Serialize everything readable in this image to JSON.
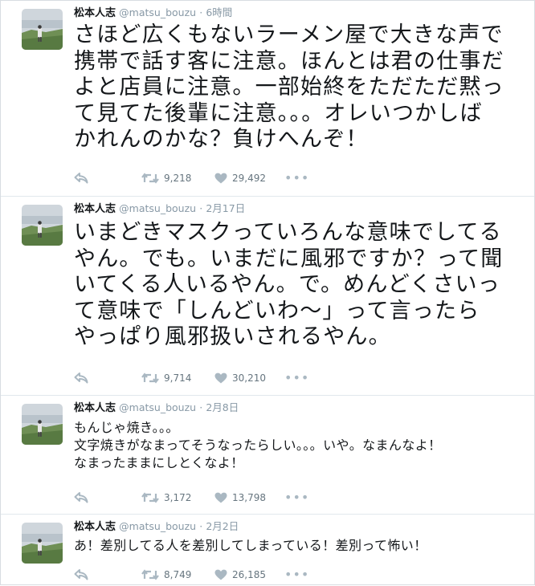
{
  "colors": {
    "accent": "#1da1f2",
    "icon": "#aab8c2",
    "meta": "#8899a6",
    "text": "#14171a",
    "border": "#e1e8ed"
  },
  "icons": [
    "reply-icon",
    "retweet-icon",
    "heart-icon",
    "more-icon"
  ],
  "tweets": [
    {
      "author": "松本人志",
      "handle": "@matsu_bouzu",
      "separator": "·",
      "time": "6時間",
      "lines": [
        "さほど広くもないラーメン屋で大きな声で",
        "携帯で話す客に注意。ほんとは君の仕事だ",
        "よと店員に注意。一部始終をただただ黙っ",
        "て見てた後輩に注意。。。オレいつかしば",
        "かれんのかな？負けへんぞ！"
      ],
      "retweets": "9,218",
      "likes": "29,492",
      "more": "•••"
    },
    {
      "author": "松本人志",
      "handle": "@matsu_bouzu",
      "separator": "·",
      "time": "2月17日",
      "lines": [
        "いまどきマスクっていろんな意味でしてる",
        "やん。でも。いまだに風邪ですか？って聞",
        "いてくる人いるやん。で。めんどくさいっ",
        "て意味で「しんどいわ〜」って言ったら",
        "やっぱり風邪扱いされるやん。"
      ],
      "retweets": "9,714",
      "likes": "30,210",
      "more": "•••"
    },
    {
      "author": "松本人志",
      "handle": "@matsu_bouzu",
      "separator": "·",
      "time": "2月8日",
      "lines": [
        "もんじゃ焼き。。。",
        "文字焼きがなまってそうなったらしい。。。いや。なまんなよ！",
        "なまったままにしとくなよ！"
      ],
      "retweets": "3,172",
      "likes": "13,798",
      "more": "•••"
    },
    {
      "author": "松本人志",
      "handle": "@matsu_bouzu",
      "separator": "·",
      "time": "2月2日",
      "lines": [
        "あ！差別してる人を差別してしまっている！差別って怖い！"
      ],
      "retweets": "8,749",
      "likes": "26,185",
      "more": "•••"
    }
  ]
}
